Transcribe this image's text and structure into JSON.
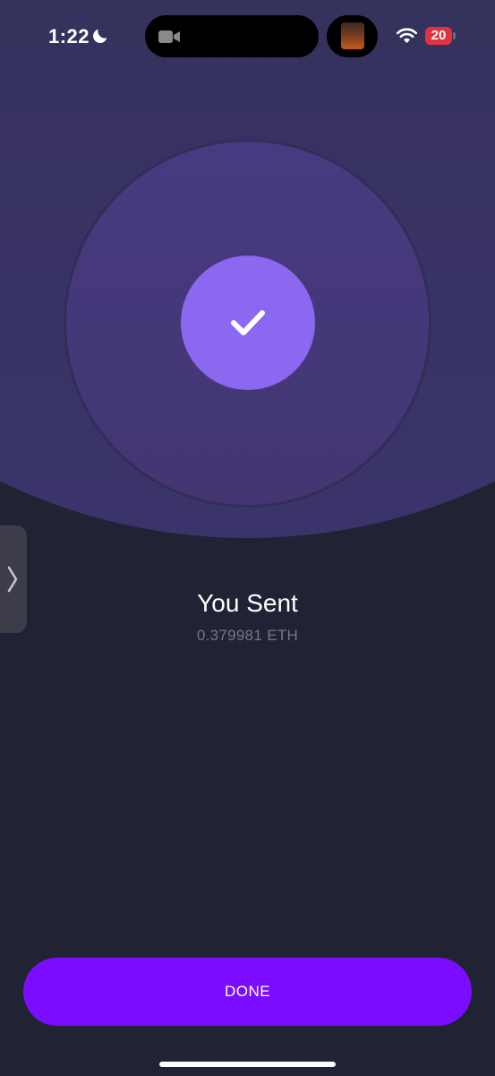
{
  "status_bar": {
    "time": "1:22",
    "battery_level": "20",
    "icons": [
      "moon-icon",
      "camera-icon",
      "wifi-icon",
      "battery-icon"
    ],
    "battery_color": "#e0333d"
  },
  "success": {
    "icon": "check-icon",
    "title": "You Sent",
    "amount": "0.379981 ETH"
  },
  "side_handle": {
    "icon": "chevron-right-icon"
  },
  "done_button": {
    "label": "DONE"
  },
  "colors": {
    "accent": "#7a0dff",
    "check_circle": "#8c67f0",
    "background": "#222235",
    "amount_text": "#767688"
  }
}
